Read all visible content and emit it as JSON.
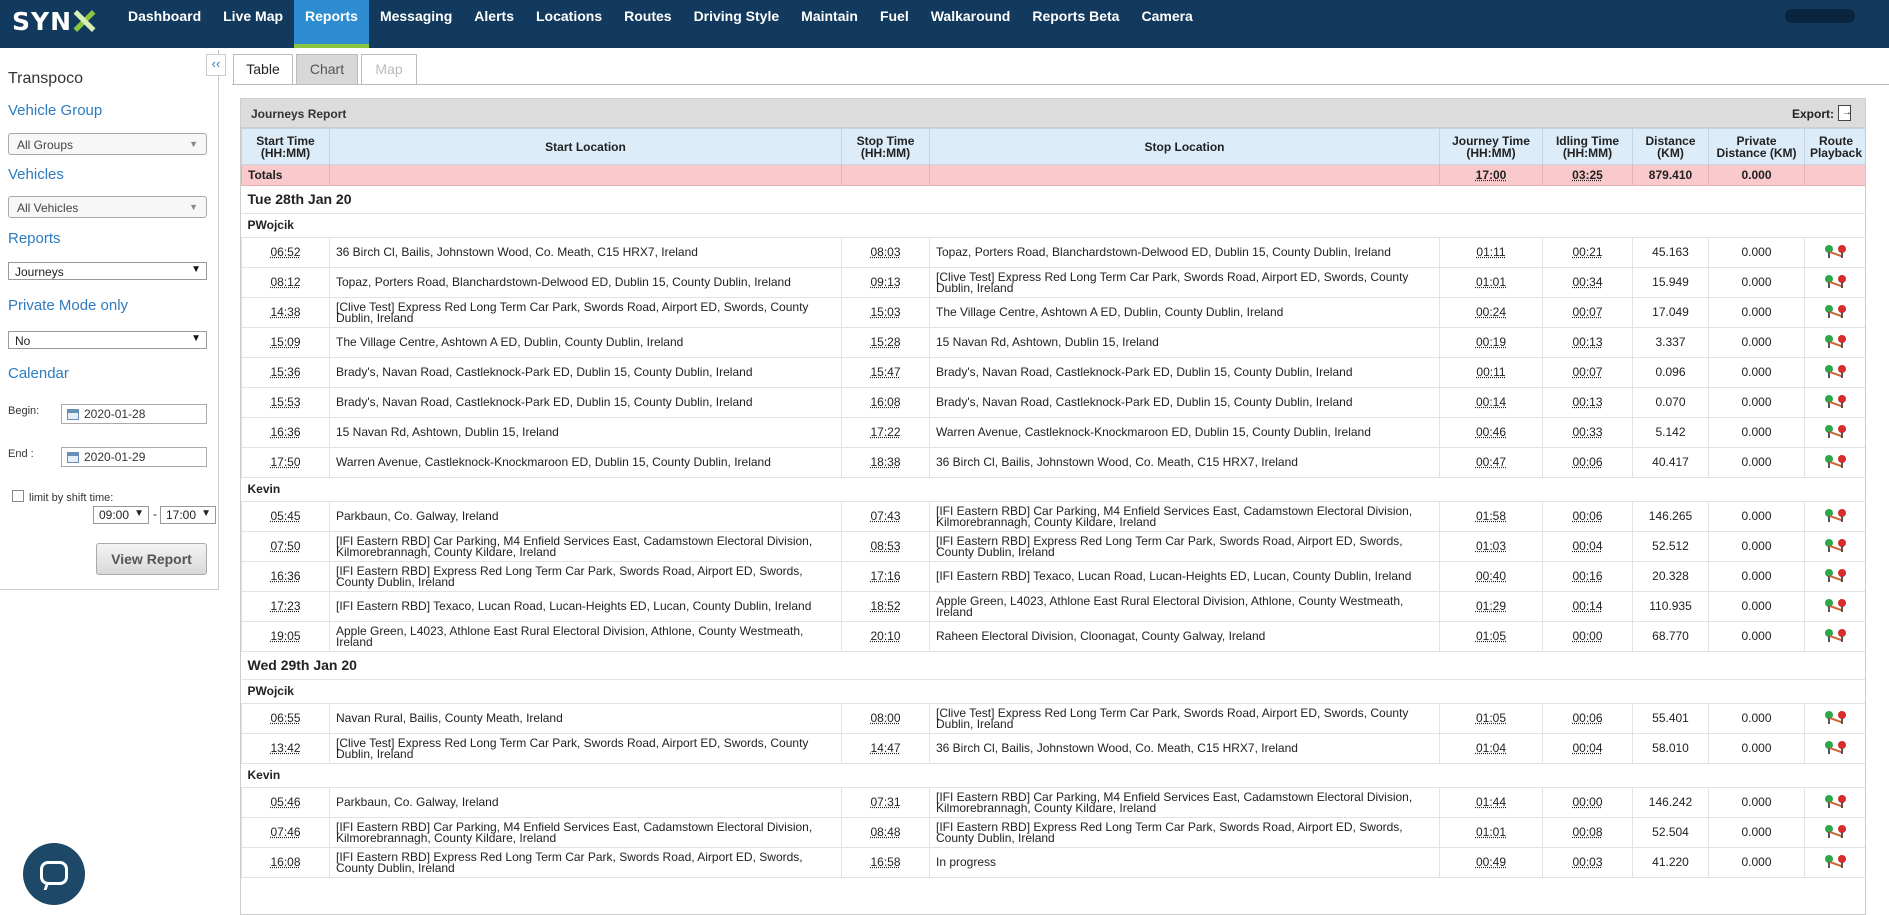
{
  "nav": {
    "logo": "SYN",
    "items": [
      "Dashboard",
      "Live Map",
      "Reports",
      "Messaging",
      "Alerts",
      "Locations",
      "Routes",
      "Driving Style",
      "Maintain",
      "Fuel",
      "Walkaround",
      "Reports Beta",
      "Camera"
    ],
    "active": "Reports"
  },
  "sidebar": {
    "collapse": "‹‹",
    "company": "Transpoco",
    "vehicle_group_label": "Vehicle Group",
    "vehicle_group_value": "All Groups",
    "vehicles_label": "Vehicles",
    "vehicles_value": "All Vehicles",
    "reports_label": "Reports",
    "reports_value": "Journeys",
    "private_label": "Private Mode only",
    "private_value": "No",
    "calendar_label": "Calendar",
    "begin_label": "Begin:",
    "begin_value": "2020-01-28",
    "end_label": "End :",
    "end_value": "2020-01-29",
    "shift_label": "limit by shift time:",
    "shift_start": "09:00",
    "shift_end": "17:00",
    "view_button": "View Report"
  },
  "tabs": [
    "Table",
    "Chart",
    "Map"
  ],
  "report": {
    "title": "Journeys Report",
    "export_label": "Export:",
    "columns": [
      "Start Time (HH:MM)",
      "Start Location",
      "Stop Time (HH:MM)",
      "Stop Location",
      "Journey Time (HH:MM)",
      "Idling Time (HH:MM)",
      "Distance (KM)",
      "Private Distance (KM)",
      "Route Playback"
    ],
    "totals": {
      "label": "Totals",
      "journey": "17:00",
      "idling": "03:25",
      "distance": "879.410",
      "private": "0.000"
    },
    "groups": [
      {
        "date": "Tue 28th Jan 20",
        "drivers": [
          {
            "name": "PWojcik",
            "rows": [
              [
                "06:52",
                "36 Birch Cl, Bailis, Johnstown Wood, Co. Meath, C15 HRX7, Ireland",
                "08:03",
                "Topaz, Porters Road, Blanchardstown-Delwood ED, Dublin 15, County Dublin, Ireland",
                "01:11",
                "00:21",
                "45.163",
                "0.000"
              ],
              [
                "08:12",
                "Topaz, Porters Road, Blanchardstown-Delwood ED, Dublin 15, County Dublin, Ireland",
                "09:13",
                "[Clive Test] Express Red Long Term Car Park, Swords Road, Airport ED, Swords, County Dublin, Ireland",
                "01:01",
                "00:34",
                "15.949",
                "0.000"
              ],
              [
                "14:38",
                "[Clive Test] Express Red Long Term Car Park, Swords Road, Airport ED, Swords, County Dublin, Ireland",
                "15:03",
                "The Village Centre, Ashtown A ED, Dublin, County Dublin, Ireland",
                "00:24",
                "00:07",
                "17.049",
                "0.000"
              ],
              [
                "15:09",
                "The Village Centre, Ashtown A ED, Dublin, County Dublin, Ireland",
                "15:28",
                "15 Navan Rd, Ashtown, Dublin 15, Ireland",
                "00:19",
                "00:13",
                "3.337",
                "0.000"
              ],
              [
                "15:36",
                "Brady's, Navan Road, Castleknock-Park ED, Dublin 15, County Dublin, Ireland",
                "15:47",
                "Brady's, Navan Road, Castleknock-Park ED, Dublin 15, County Dublin, Ireland",
                "00:11",
                "00:07",
                "0.096",
                "0.000"
              ],
              [
                "15:53",
                "Brady's, Navan Road, Castleknock-Park ED, Dublin 15, County Dublin, Ireland",
                "16:08",
                "Brady's, Navan Road, Castleknock-Park ED, Dublin 15, County Dublin, Ireland",
                "00:14",
                "00:13",
                "0.070",
                "0.000"
              ],
              [
                "16:36",
                "15 Navan Rd, Ashtown, Dublin 15, Ireland",
                "17:22",
                "Warren Avenue, Castleknock-Knockmaroon ED, Dublin 15, County Dublin, Ireland",
                "00:46",
                "00:33",
                "5.142",
                "0.000"
              ],
              [
                "17:50",
                "Warren Avenue, Castleknock-Knockmaroon ED, Dublin 15, County Dublin, Ireland",
                "18:38",
                "36 Birch Cl, Bailis, Johnstown Wood, Co. Meath, C15 HRX7, Ireland",
                "00:47",
                "00:06",
                "40.417",
                "0.000"
              ]
            ]
          },
          {
            "name": "Kevin",
            "rows": [
              [
                "05:45",
                "Parkbaun, Co. Galway, Ireland",
                "07:43",
                "[IFI Eastern RBD] Car Parking, M4 Enfield Services East, Cadamstown Electoral Division, Kilmorebrannagh, County Kildare, Ireland",
                "01:58",
                "00:06",
                "146.265",
                "0.000"
              ],
              [
                "07:50",
                "[IFI Eastern RBD] Car Parking, M4 Enfield Services East, Cadamstown Electoral Division, Kilmorebrannagh, County Kildare, Ireland",
                "08:53",
                "[IFI Eastern RBD] Express Red Long Term Car Park, Swords Road, Airport ED, Swords, County Dublin, Ireland",
                "01:03",
                "00:04",
                "52.512",
                "0.000"
              ],
              [
                "16:36",
                "[IFI Eastern RBD] Express Red Long Term Car Park, Swords Road, Airport ED, Swords, County Dublin, Ireland",
                "17:16",
                "[IFI Eastern RBD] Texaco, Lucan Road, Lucan-Heights ED, Lucan, County Dublin, Ireland",
                "00:40",
                "00:16",
                "20.328",
                "0.000"
              ],
              [
                "17:23",
                "[IFI Eastern RBD] Texaco, Lucan Road, Lucan-Heights ED, Lucan, County Dublin, Ireland",
                "18:52",
                "Apple Green, L4023, Athlone East Rural Electoral Division, Athlone, County Westmeath, Ireland",
                "01:29",
                "00:14",
                "110.935",
                "0.000"
              ],
              [
                "19:05",
                "Apple Green, L4023, Athlone East Rural Electoral Division, Athlone, County Westmeath, Ireland",
                "20:10",
                "Raheen Electoral Division, Cloonagat, County Galway, Ireland",
                "01:05",
                "00:00",
                "68.770",
                "0.000"
              ]
            ]
          }
        ]
      },
      {
        "date": "Wed 29th Jan 20",
        "drivers": [
          {
            "name": "PWojcik",
            "rows": [
              [
                "06:55",
                "Navan Rural, Bailis, County Meath, Ireland",
                "08:00",
                "[Clive Test] Express Red Long Term Car Park, Swords Road, Airport ED, Swords, County Dublin, Ireland",
                "01:05",
                "00:06",
                "55.401",
                "0.000"
              ],
              [
                "13:42",
                "[Clive Test] Express Red Long Term Car Park, Swords Road, Airport ED, Swords, County Dublin, Ireland",
                "14:47",
                "36 Birch Cl, Bailis, Johnstown Wood, Co. Meath, C15 HRX7, Ireland",
                "01:04",
                "00:04",
                "58.010",
                "0.000"
              ]
            ]
          },
          {
            "name": "Kevin",
            "rows": [
              [
                "05:46",
                "Parkbaun, Co. Galway, Ireland",
                "07:31",
                "[IFI Eastern RBD] Car Parking, M4 Enfield Services East, Cadamstown Electoral Division, Kilmorebrannagh, County Kildare, Ireland",
                "01:44",
                "00:00",
                "146.242",
                "0.000"
              ],
              [
                "07:46",
                "[IFI Eastern RBD] Car Parking, M4 Enfield Services East, Cadamstown Electoral Division, Kilmorebrannagh, County Kildare, Ireland",
                "08:48",
                "[IFI Eastern RBD] Express Red Long Term Car Park, Swords Road, Airport ED, Swords, County Dublin, Ireland",
                "01:01",
                "00:08",
                "52.504",
                "0.000"
              ],
              [
                "16:08",
                "[IFI Eastern RBD] Express Red Long Term Car Park, Swords Road, Airport ED, Swords, County Dublin, Ireland",
                "16:58",
                "In progress",
                "00:49",
                "00:03",
                "41.220",
                "0.000"
              ]
            ]
          }
        ]
      }
    ]
  }
}
